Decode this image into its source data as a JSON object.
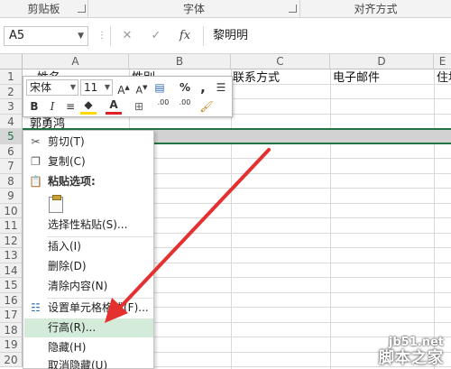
{
  "ribbon": {
    "groups": [
      "剪贴板",
      "字体",
      "对齐方式"
    ]
  },
  "formula_bar": {
    "name_box": "A5",
    "fx_label": "fx",
    "formula_value": "黎明明"
  },
  "grid": {
    "columns": [
      "A",
      "B",
      "C",
      "D",
      "E"
    ],
    "rows": [
      "1",
      "2",
      "3",
      "4",
      "5",
      "6",
      "7",
      "8",
      "9",
      "10",
      "11",
      "12",
      "13",
      "14",
      "15",
      "16",
      "17",
      "18",
      "19",
      "20"
    ],
    "cells": {
      "A1": "姓名",
      "B1": "性别",
      "C1": "联系方式",
      "D1": "电子邮件",
      "E1": "住址",
      "A4": "郭勇鸿",
      "A5": "黎明明"
    },
    "selected_row": "5",
    "accent_color": "#217346"
  },
  "mini_toolbar": {
    "font_name": "宋体",
    "font_size": "11",
    "percent": "%",
    "comma": ",",
    "bold": "B",
    "italic": "I",
    "dec_inc": ".00",
    "dec_dec": ".00"
  },
  "context_menu": {
    "items": [
      {
        "label": "剪切(T)",
        "icon": "scissors-icon"
      },
      {
        "label": "复制(C)",
        "icon": "copy-icon"
      },
      {
        "label": "粘贴选项:",
        "icon": "paste-options-icon"
      },
      {
        "label": "选择性粘贴(S)...",
        "icon": ""
      },
      {
        "label": "插入(I)",
        "icon": ""
      },
      {
        "label": "删除(D)",
        "icon": ""
      },
      {
        "label": "清除内容(N)",
        "icon": ""
      },
      {
        "label": "设置单元格格式(F)...",
        "icon": "format-cells-icon"
      },
      {
        "label": "行高(R)...",
        "icon": ""
      },
      {
        "label": "隐藏(H)",
        "icon": ""
      },
      {
        "label": "取消隐藏(U)",
        "icon": ""
      }
    ],
    "highlight_color": "#d5ebd9"
  },
  "watermark": {
    "url": "jb51.net",
    "name": "脚本之家"
  }
}
